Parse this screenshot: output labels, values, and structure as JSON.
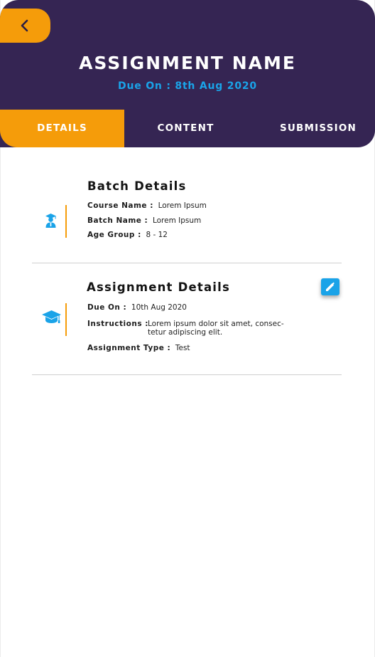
{
  "header": {
    "title": "ASSIGNMENT NAME",
    "due_text": "Due On : 8th Aug 2020",
    "back_icon": "chevron-left-icon"
  },
  "tabs": [
    {
      "label": "DETAILS",
      "active": true
    },
    {
      "label": "CONTENT",
      "active": false
    },
    {
      "label": "SUBMISSION",
      "active": false
    }
  ],
  "batch": {
    "title": "Batch Details",
    "icon": "student-graduate-icon",
    "fields": [
      {
        "label": "Course Name :",
        "value": "Lorem Ipsum"
      },
      {
        "label": "Batch Name :",
        "value": "Lorem Ipsum"
      },
      {
        "label": "Age Group :",
        "value": "8 - 12"
      }
    ]
  },
  "assignment": {
    "title": "Assignment Details",
    "icon": "graduation-cap-icon",
    "edit_icon": "pencil-icon",
    "fields": [
      {
        "label": "Due On :",
        "value": "10th Aug 2020"
      },
      {
        "label": "Instructions :",
        "value_line1": "Lorem ipsum dolor sit amet, consec-",
        "value_line2": "tetur adipiscing elit."
      },
      {
        "label": "Assignment Type :",
        "value": "Test"
      }
    ]
  },
  "colors": {
    "header_bg": "#352553",
    "accent_orange": "#f59c0a",
    "accent_blue": "#1aa3e8"
  }
}
